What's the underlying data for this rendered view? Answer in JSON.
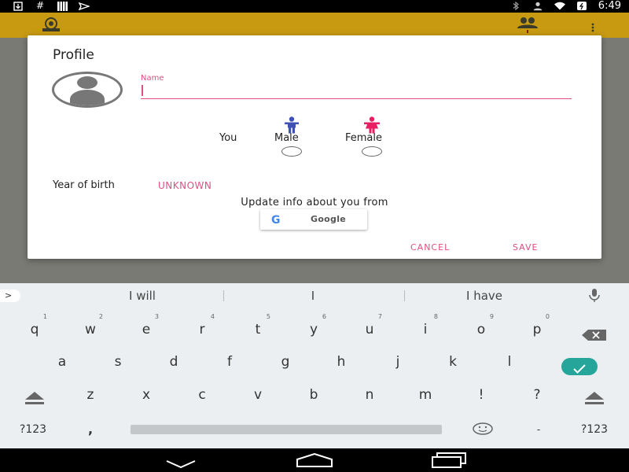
{
  "status_bar": {
    "left_icons": [
      "download-icon",
      "hash-icon",
      "signal-bars-icon",
      "send-icon"
    ],
    "right_icons": [
      "bluetooth-icon",
      "contacts-icon",
      "wifi-icon",
      "battery-icon"
    ],
    "time": "6:49"
  },
  "dialog": {
    "title": "Profile",
    "name_label": "Name",
    "name_value": "",
    "you_label": "You",
    "male_label": "Male",
    "female_label": "Female",
    "year_label": "Year of birth",
    "year_value": "UNKNOWN",
    "update_text": "Update info about you from",
    "google_button": "Google",
    "google_logo": "G",
    "cancel": "CANCEL",
    "save": "SAVE"
  },
  "colors": {
    "accent": "#e04e82",
    "male_icon": "#3f51b5",
    "female_icon": "#e91e63",
    "app_bar": "#c79a12",
    "enter_key": "#26a69a"
  },
  "suggestions": [
    "I will",
    "I",
    "I have"
  ],
  "suggestion_arrow": ">",
  "keyboard": {
    "row1": [
      {
        "k": "q",
        "h": "1"
      },
      {
        "k": "w",
        "h": "2"
      },
      {
        "k": "e",
        "h": "3"
      },
      {
        "k": "r",
        "h": "4"
      },
      {
        "k": "t",
        "h": "5"
      },
      {
        "k": "y",
        "h": "6"
      },
      {
        "k": "u",
        "h": "7"
      },
      {
        "k": "i",
        "h": "8"
      },
      {
        "k": "o",
        "h": "9"
      },
      {
        "k": "p",
        "h": "0"
      }
    ],
    "row2": [
      "a",
      "s",
      "d",
      "f",
      "g",
      "h",
      "j",
      "k",
      "l"
    ],
    "row3": [
      "z",
      "x",
      "c",
      "v",
      "b",
      "n",
      "m",
      "!",
      "?"
    ],
    "row4": {
      "left_symbols": "?123",
      "comma": ",",
      "dash": "-",
      "right_symbols": "?123"
    }
  }
}
